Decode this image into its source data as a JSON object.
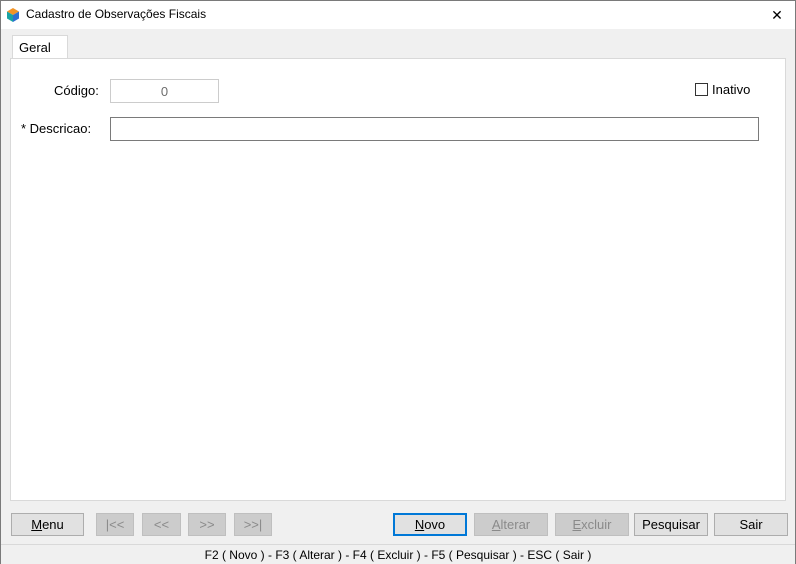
{
  "window": {
    "title": "Cadastro de Observações Fiscais",
    "close_symbol": "✕"
  },
  "tabs": [
    {
      "label": "Geral",
      "active": true
    }
  ],
  "form": {
    "codigo_label": "Código:",
    "codigo_value": "0",
    "inativo_label": "Inativo",
    "inativo_checked": false,
    "descricao_label": "* Descricao:",
    "descricao_value": ""
  },
  "buttons": {
    "menu": {
      "hotkey": "M",
      "rest": "enu"
    },
    "first": "|<<",
    "prev": "<<",
    "next": ">>",
    "last": ">>|",
    "novo": {
      "hotkey": "N",
      "rest": "ovo"
    },
    "alterar": {
      "hotkey": "A",
      "rest": "lterar"
    },
    "excluir": {
      "hotkey": "E",
      "rest": "xcluir"
    },
    "pesquisar": "Pesquisar",
    "sair": "Sair"
  },
  "status": {
    "shortcuts": "F2 ( Novo )  -  F3 ( Alterar )  -  F4 ( Excluir )  -  F5 ( Pesquisar )  -  ESC ( Sair )"
  },
  "colors": {
    "app_icon_orange": "#f29425",
    "app_icon_teal": "#1aa3a3",
    "app_icon_blue": "#2e6fd0",
    "focus_blue": "#0078d7"
  }
}
